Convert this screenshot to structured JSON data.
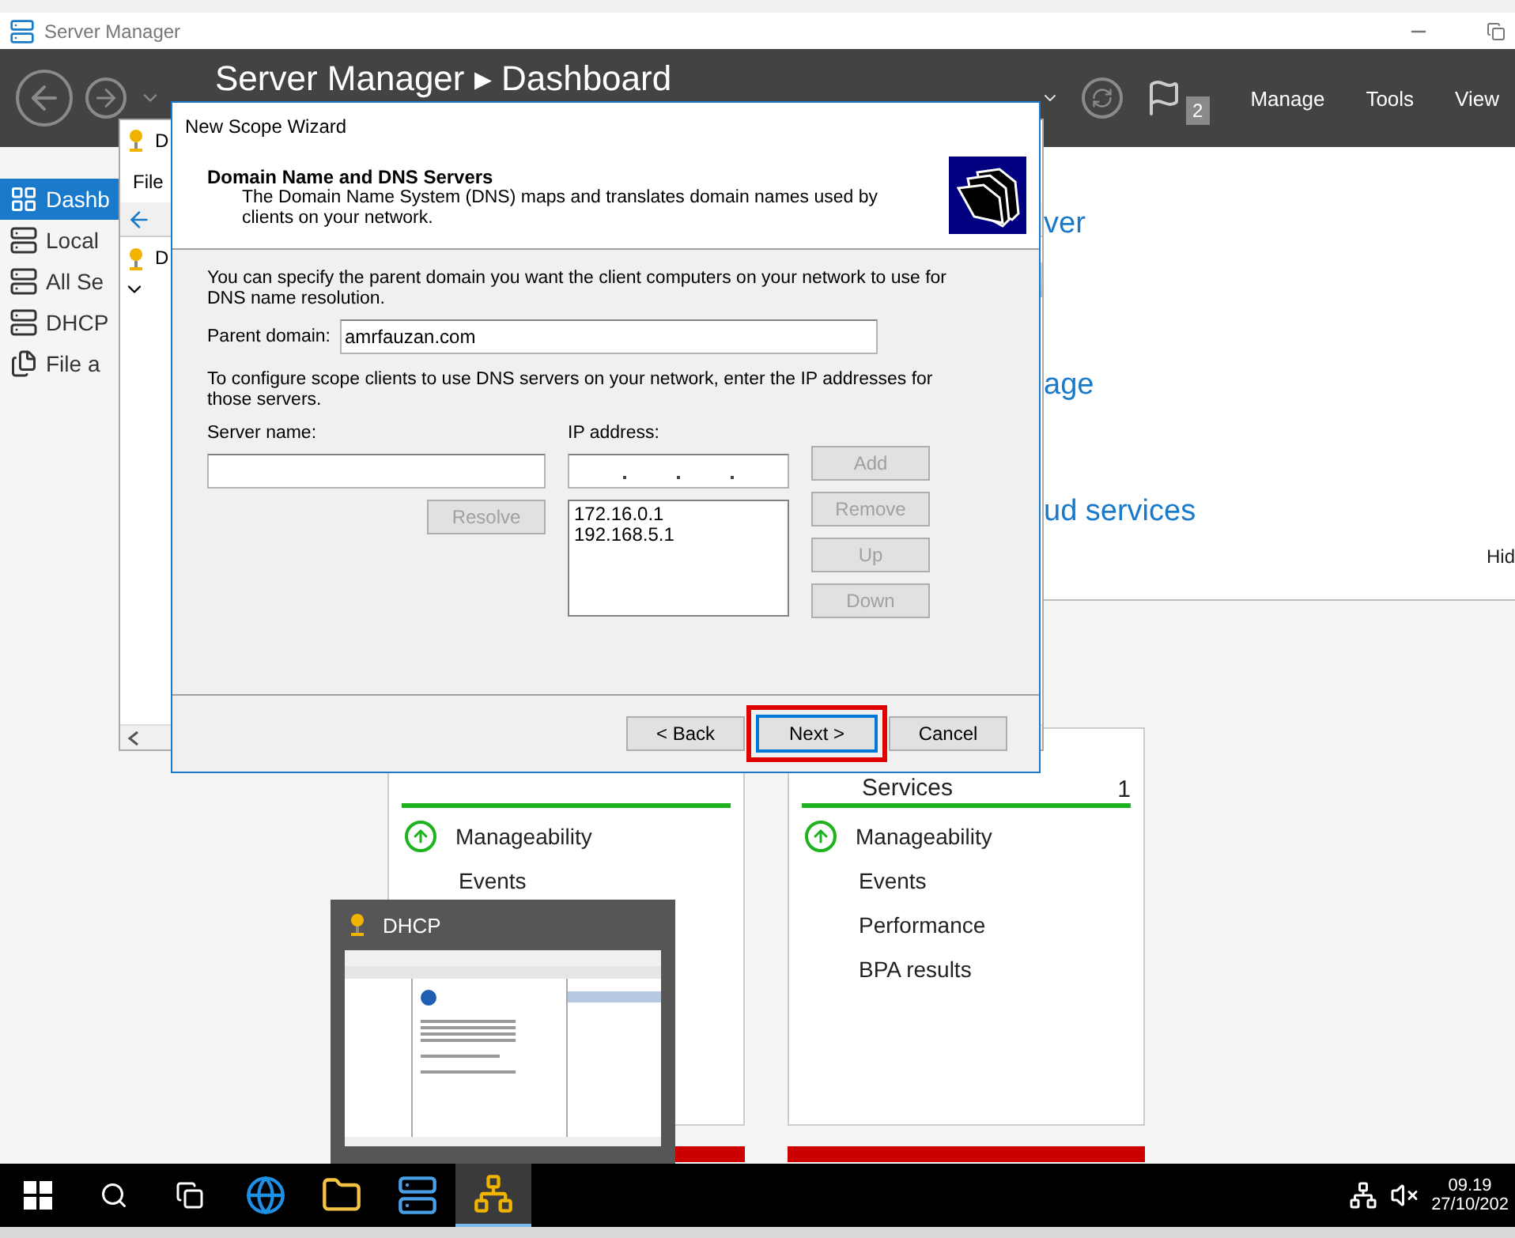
{
  "server_manager": {
    "title": "Server Manager",
    "breadcrumb": "Server Manager ▸ Dashboard",
    "menus": [
      "Manage",
      "Tools",
      "View"
    ],
    "notification_count": "2",
    "sidebar": [
      {
        "label": "Dashb",
        "kind": "dashboard",
        "selected": true
      },
      {
        "label": "Local",
        "kind": "server",
        "selected": false
      },
      {
        "label": "All Se",
        "kind": "servers",
        "selected": false
      },
      {
        "label": "DHCP",
        "kind": "role",
        "selected": false
      },
      {
        "label": "File a",
        "kind": "files",
        "selected": false
      }
    ],
    "content_links": [
      "ver",
      "age",
      "ud services"
    ],
    "hide_link": "Hid",
    "tiles": [
      {
        "items": [
          {
            "label": "Manageability",
            "kind": "health"
          },
          {
            "label": "Events",
            "kind": "plain"
          }
        ]
      },
      {
        "title": "Services",
        "count": "1",
        "items": [
          {
            "label": "Manageability",
            "kind": "health"
          },
          {
            "label": "Events",
            "kind": "plain"
          },
          {
            "label": "Performance",
            "kind": "plain"
          },
          {
            "label": "BPA results",
            "kind": "plain"
          }
        ]
      }
    ]
  },
  "dhcp_console": {
    "menu": "File",
    "tree_root": "D",
    "title_initial": "D"
  },
  "wizard": {
    "title": "New Scope Wizard",
    "heading": "Domain Name and DNS Servers",
    "subtitle": "The Domain Name System (DNS) maps and translates domain names used by clients on your network.",
    "intro": "You can specify the parent domain you want the client computers on your network to use for DNS name resolution.",
    "parent_domain_label": "Parent domain:",
    "parent_domain": "amrfauzan.com",
    "servers_intro": "To configure scope clients to use DNS servers on your network, enter the IP addresses for those servers.",
    "server_name_label": "Server name:",
    "ip_label": "IP address:",
    "resolve": {
      "label": "Resolve",
      "disabled": true
    },
    "ip_list": [
      "172.16.0.1",
      "192.168.5.1"
    ],
    "side_buttons": [
      {
        "label": "Add",
        "disabled": true
      },
      {
        "label": "Remove",
        "disabled": true
      },
      {
        "label": "Up",
        "disabled": true
      },
      {
        "label": "Down",
        "disabled": true
      }
    ],
    "footer_buttons": [
      {
        "label": "< Back",
        "focused": false,
        "highlighted": false
      },
      {
        "label": "Next >",
        "focused": true,
        "highlighted": true
      },
      {
        "label": "Cancel",
        "focused": false,
        "highlighted": false
      }
    ]
  },
  "thumbnail": {
    "title": "DHCP"
  },
  "taskbar": {
    "apps": [
      {
        "kind": "browser",
        "active": false
      },
      {
        "kind": "folder",
        "active": false
      },
      {
        "kind": "server",
        "active": false
      },
      {
        "kind": "dhcp",
        "active": true
      }
    ],
    "time": "09.19",
    "date": "27/10/202"
  }
}
